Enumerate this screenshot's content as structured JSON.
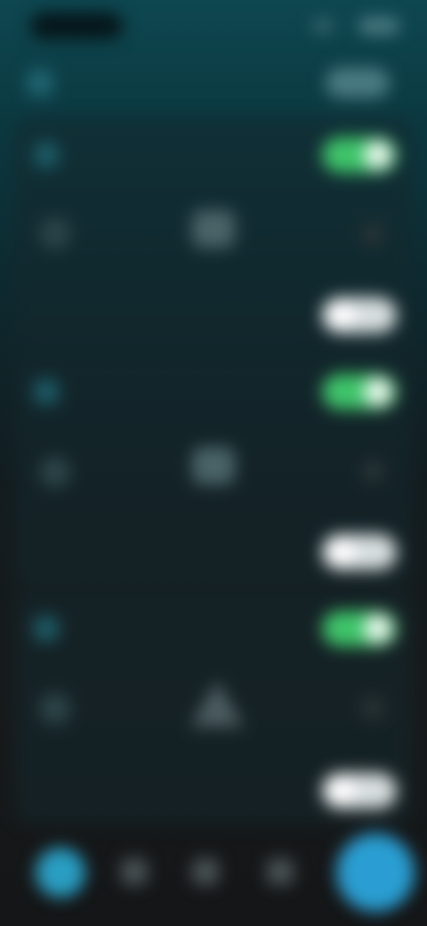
{
  "status_bar": {
    "time": ""
  },
  "header": {
    "title": ""
  },
  "cards": [
    {
      "label": "",
      "toggle_on": true,
      "sub_label": "",
      "sub_toggle_on": false
    },
    {
      "label": "",
      "toggle_on": true,
      "sub_label": "",
      "sub_toggle_on": false
    },
    {
      "label": "",
      "toggle_on": true,
      "sub_label": "",
      "sub_toggle_on": false
    }
  ],
  "colors": {
    "accent_green": "#3fc46a",
    "accent_blue": "#2a9ed2",
    "background_top": "#0e4750",
    "background_bottom": "#141617"
  },
  "icons": {
    "header": "app-icon",
    "row": "device-icon",
    "control_left": "circle-icon",
    "control_mid_1": "square-icon",
    "control_mid_2": "square-icon",
    "control_mid_3": "triangle-icon",
    "control_right": "dot-icon",
    "nav": [
      "home-icon",
      "grid-icon",
      "list-icon",
      "settings-icon"
    ],
    "fab": "add-icon"
  }
}
